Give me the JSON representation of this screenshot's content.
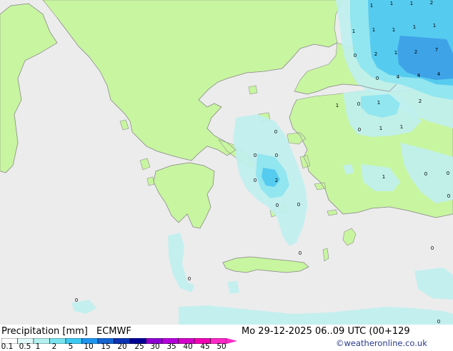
{
  "footer": {
    "legend_title": "Precipitation [mm]",
    "model": "ECMWF",
    "valid_time": "Mo 29-12-2025 06..09 UTC (00+129",
    "credit": "©weatheronline.co.uk"
  },
  "colorbar": {
    "ticks": [
      "0.1",
      "0.5",
      "1",
      "2",
      "5",
      "10",
      "15",
      "20",
      "25",
      "30",
      "35",
      "40",
      "45",
      "50"
    ],
    "colors": [
      "#ffffff",
      "#e0f8f8",
      "#b4f0f0",
      "#78e4f0",
      "#3cc8f0",
      "#1e96f0",
      "#1464d2",
      "#0a32b4",
      "#000096",
      "#8c00d2",
      "#b400dc",
      "#d200c8",
      "#f000b4",
      "#ff28c8"
    ]
  },
  "map": {
    "colors": {
      "sea": "#ececec",
      "land": "#c8f5a0",
      "coast": "#8c8c8c",
      "precip_light": "#c0f0f0",
      "precip_moderate": "#8ce4f0",
      "precip_heavy": "#50c8f0",
      "precip_max": "#3c9ee6"
    },
    "precip_labels": [
      "1",
      "1",
      "1",
      "2",
      "1",
      "1",
      "1",
      "1",
      "1",
      "0",
      "2",
      "1",
      "2",
      "7",
      "0",
      "4",
      "4",
      "4",
      "1",
      "0",
      "1",
      "2",
      "0",
      "1",
      "1",
      "0",
      "0",
      "0",
      "0",
      "2",
      "1",
      "0",
      "0",
      "0",
      "0",
      "0",
      "0",
      "0",
      "0",
      "0",
      "0",
      "0"
    ]
  }
}
